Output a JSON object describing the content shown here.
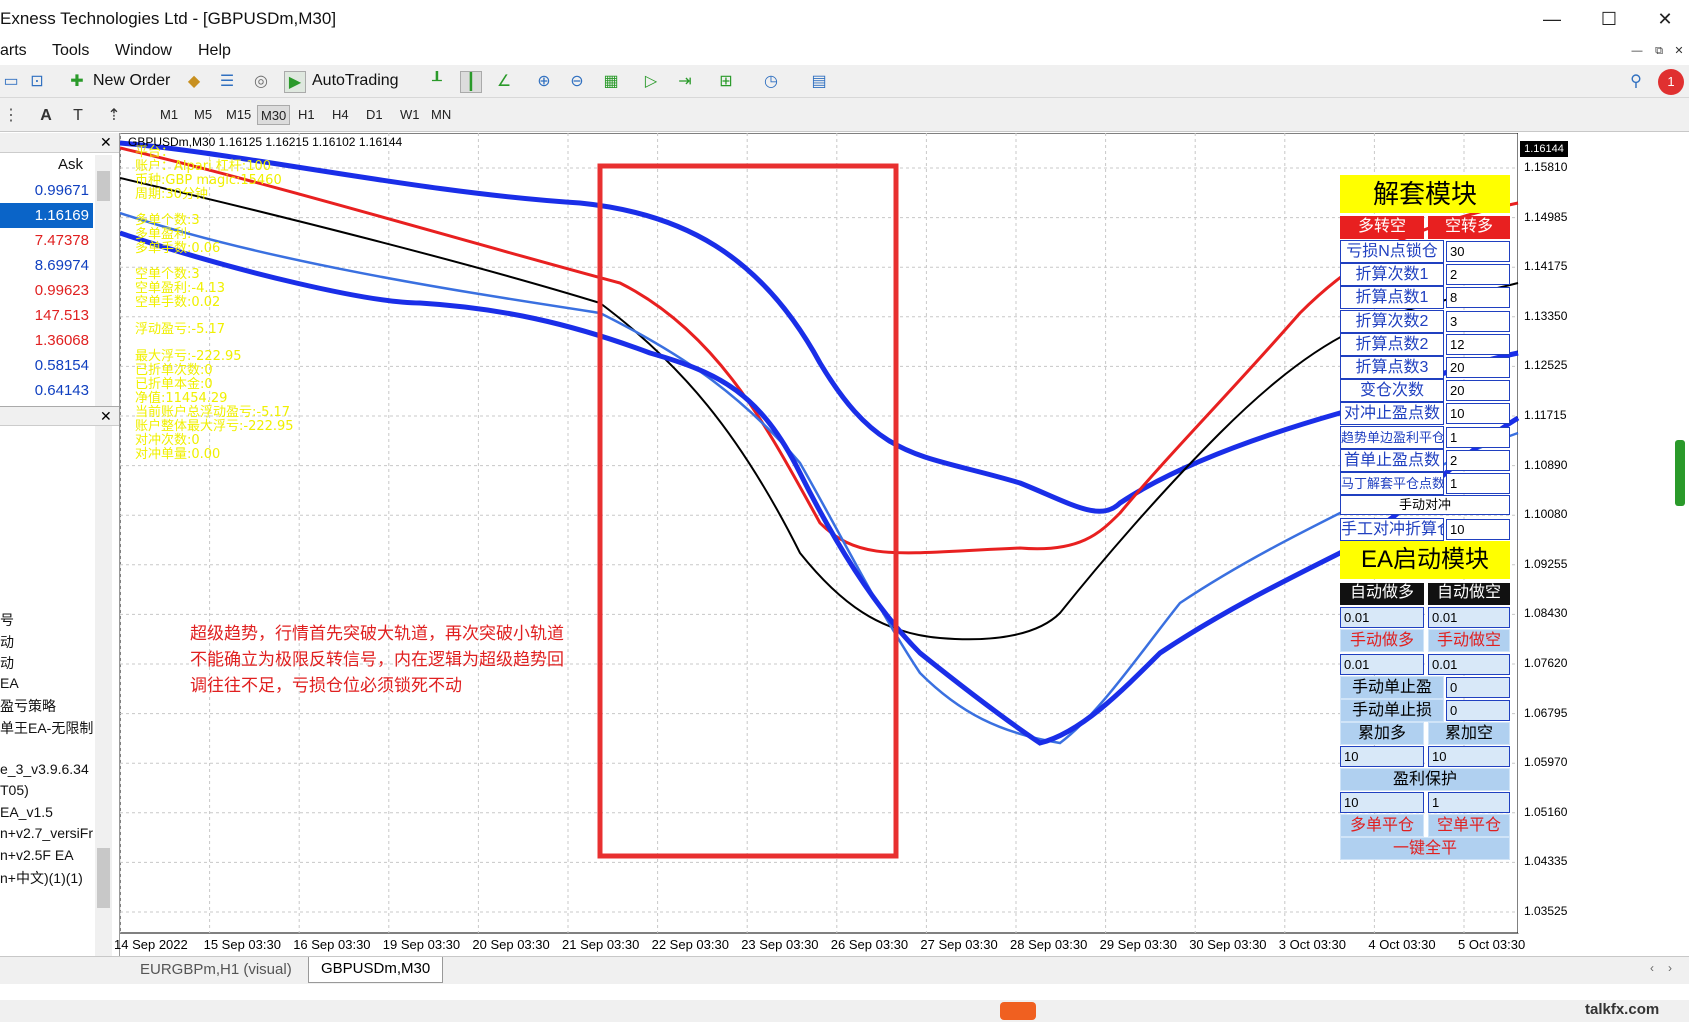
{
  "window": {
    "title": "Exness Technologies Ltd - [GBPUSDm,M30]",
    "minimize": "—",
    "maximize": "☐",
    "close": "✕"
  },
  "menu": [
    "arts",
    "Tools",
    "Window",
    "Help"
  ],
  "toolbar": {
    "new_order": "New Order",
    "autotrading": "AutoTrading"
  },
  "timeframes": [
    "M1",
    "M5",
    "M15",
    "M30",
    "H1",
    "H4",
    "D1",
    "W1",
    "MN"
  ],
  "active_timeframe": "M30",
  "market_watch": {
    "header": "Ask",
    "quotes": [
      {
        "value": "0.99671",
        "color": "#1040c0",
        "selected": false
      },
      {
        "value": "1.16169",
        "color": "#ffffff",
        "selected": true
      },
      {
        "value": "7.47378",
        "color": "#e02020",
        "selected": false
      },
      {
        "value": "8.69974",
        "color": "#1040c0",
        "selected": false
      },
      {
        "value": "0.99623",
        "color": "#e02020",
        "selected": false
      },
      {
        "value": "147.513",
        "color": "#e02020",
        "selected": false
      },
      {
        "value": "1.36068",
        "color": "#e02020",
        "selected": false
      },
      {
        "value": "0.58154",
        "color": "#1040c0",
        "selected": false
      },
      {
        "value": "0.64143",
        "color": "#1040c0",
        "selected": false
      }
    ]
  },
  "navigator": {
    "items": [
      "号",
      "动",
      "动",
      "EA",
      "盈亏策略",
      "单王EA-无限制",
      "",
      "e_3_v3.9.6.34",
      "T05)",
      "EA_v1.5",
      "n+v2.7_versiFr",
      "n+v2.5F EA",
      "n+中文)(1)(1)"
    ]
  },
  "chart": {
    "header": "GBPUSDm,M30  1.16125 1.16215 1.16102 1.16144",
    "current_price": "1.16144",
    "annotation_lines": [
      "超级趋势，行情首先突破大轨道，再次突破小轨道",
      "不能确立为极限反转信号，内在逻辑为超级趋势回",
      "调往往不足，亏损仓位必须锁死不动"
    ],
    "y_ticks": [
      "1.15810",
      "1.14985",
      "1.14175",
      "1.13350",
      "1.12525",
      "1.11715",
      "1.10890",
      "1.10080",
      "1.09255",
      "1.08430",
      "1.07620",
      "1.06795",
      "1.05970",
      "1.05160",
      "1.04335",
      "1.03525"
    ],
    "x_ticks": [
      "14 Sep 2022",
      "15 Sep 03:30",
      "16 Sep 03:30",
      "19 Sep 03:30",
      "20 Sep 03:30",
      "21 Sep 03:30",
      "22 Sep 03:30",
      "23 Sep 03:30",
      "26 Sep 03:30",
      "27 Sep 03:30",
      "28 Sep 03:30",
      "29 Sep 03:30",
      "30 Sep 03:30",
      "3 Oct 03:30",
      "4 Oct 03:30",
      "5 Oct 03:30"
    ],
    "info_yellow": [
      "平台：",
      "账户：Alpari 杠杆:100",
      "币种:GBP magic:15460",
      "周期:30分钟",
      "多单个数:3",
      "多单盈利:",
      "多单手数:0.06",
      "空单个数:3",
      "空单盈利:-4.13",
      "空单手数:0.02",
      "浮动盈亏:-5.17",
      "最大浮亏:-222.95",
      "已折单次数:0",
      "已折单本金:0",
      "净值:11454.29",
      "当前账户总浮动盈亏:-5.17",
      "账户整体最大浮亏:-222.95",
      "对冲次数:0",
      "对冲单量:0.00"
    ]
  },
  "ea_panel": {
    "unlock_title": "解套模块",
    "long_to_short": "多转空",
    "short_to_long": "空转多",
    "rows": [
      {
        "label": "亏损N点锁仓",
        "value": "30"
      },
      {
        "label": "折算次数1",
        "value": "2"
      },
      {
        "label": "折算点数1",
        "value": "8"
      },
      {
        "label": "折算次数2",
        "value": "3"
      },
      {
        "label": "折算点数2",
        "value": "12"
      },
      {
        "label": "折算点数3",
        "value": "20"
      },
      {
        "label": "变仓次数",
        "value": "20"
      },
      {
        "label": "对冲止盈点数",
        "value": "10"
      },
      {
        "label": "趋势单边盈利平仓点数",
        "value": "1"
      },
      {
        "label": "首单止盈点数",
        "value": "2"
      },
      {
        "label": "马丁解套平仓点数",
        "value": "1"
      }
    ],
    "manual_hedge": "手动对冲",
    "manual_hedge_label": "手工对冲折算仓位",
    "manual_hedge_value": "10",
    "start_title": "EA启动模块",
    "auto_long": "自动做多",
    "auto_short": "自动做空",
    "auto_long_lot": "0.01",
    "auto_short_lot": "0.01",
    "manual_long": "手动做多",
    "manual_short": "手动做空",
    "manual_long_lot": "0.01",
    "manual_short_lot": "0.01",
    "manual_tp": "手动单止盈",
    "manual_tp_value": "0",
    "manual_sl": "手动单止损",
    "manual_sl_value": "0",
    "add_long": "累加多",
    "add_short": "累加空",
    "add_long_value": "10",
    "add_short_value": "10",
    "profit_protect": "盈利保护",
    "protect_v1": "10",
    "protect_v2": "1",
    "close_long": "多单平仓",
    "close_short": "空单平仓",
    "close_all": "一键全平"
  },
  "tabs": [
    "EURGBPm,H1 (visual)",
    "GBPUSDm,M30"
  ],
  "watermark": "talkfx.com"
}
